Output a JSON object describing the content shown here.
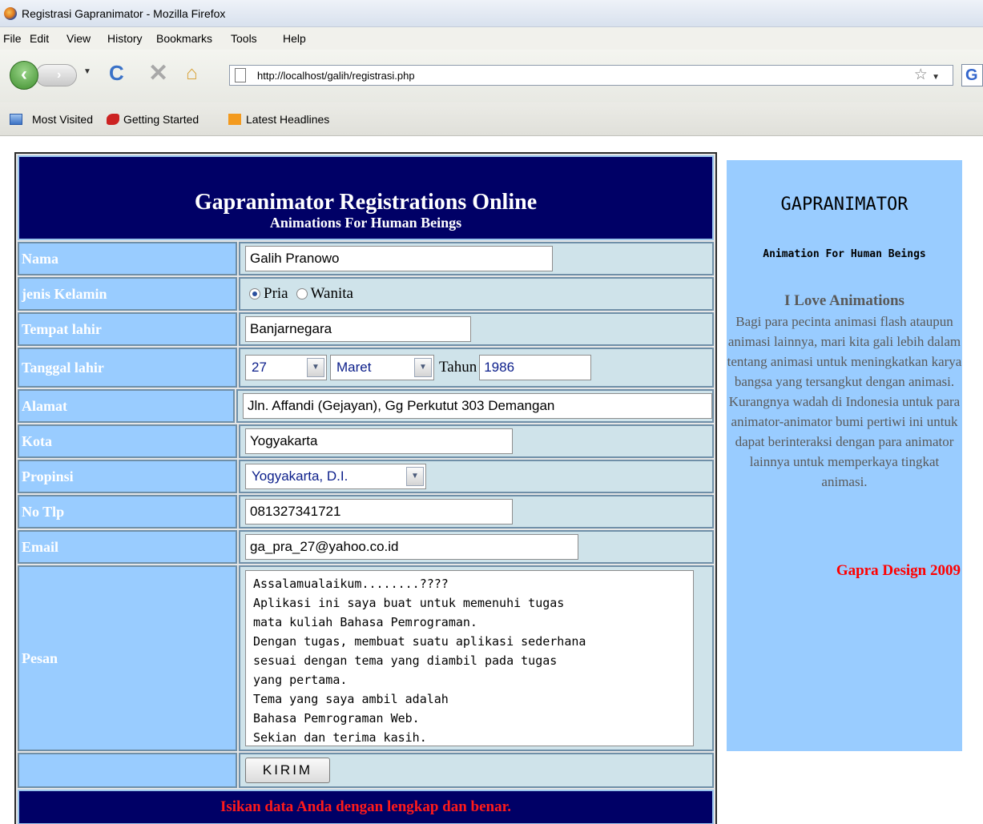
{
  "window": {
    "title": "Registrasi Gapranimator - Mozilla Firefox"
  },
  "menu": [
    "File",
    "Edit",
    "View",
    "History",
    "Bookmarks",
    "Tools",
    "Help"
  ],
  "toolbar": {
    "url": "http://localhost/galih/registrasi.php",
    "search_engine": "G"
  },
  "bookmarks": [
    "Most Visited",
    "Getting Started",
    "Latest Headlines"
  ],
  "form": {
    "title": "Gapranimator Registrations Online",
    "subtitle": "Animations For Human Beings",
    "fields": {
      "nama": {
        "label": "Nama",
        "value": "Galih Pranowo"
      },
      "gender": {
        "label": "jenis Kelamin",
        "options": [
          "Pria",
          "Wanita"
        ],
        "selected": "Pria"
      },
      "tempat_lahir": {
        "label": "Tempat lahir",
        "value": "Banjarnegara"
      },
      "tanggal_lahir": {
        "label": "Tanggal lahir",
        "day": "27",
        "month": "Maret",
        "year_label": "Tahun",
        "year": "1986"
      },
      "alamat": {
        "label": "Alamat",
        "value": "Jln. Affandi (Gejayan), Gg Perkutut 303 Demangan"
      },
      "kota": {
        "label": "Kota",
        "value": "Yogyakarta"
      },
      "propinsi": {
        "label": "Propinsi",
        "value": "Yogyakarta, D.I."
      },
      "no_tlp": {
        "label": "No Tlp",
        "value": "081327341721"
      },
      "email": {
        "label": "Email",
        "value": "ga_pra_27@yahoo.co.id"
      },
      "pesan": {
        "label": "Pesan",
        "value": "Assalamualaikum........????\nAplikasi ini saya buat untuk memenuhi tugas\nmata kuliah Bahasa Pemrograman.\nDengan tugas, membuat suatu aplikasi sederhana\nsesuai dengan tema yang diambil pada tugas\nyang pertama.\nTema yang saya ambil adalah\nBahasa Pemrograman Web.\nSekian dan terima kasih."
      }
    },
    "submit_label": "KIRIM",
    "footer_note": "Isikan data Anda dengan lengkap dan benar."
  },
  "sidebar": {
    "title": "GAPRANIMATOR",
    "subtitle": "Animation For Human Beings",
    "heading": "I Love Animations",
    "body": "Bagi para pecinta animasi flash ataupun animasi lainnya, mari kita gali lebih dalam tentang animasi untuk meningkatkan karya bangsa yang tersangkut dengan animasi. Kurangnya wadah di Indonesia untuk para animator-animator bumi pertiwi ini untuk dapat berinteraksi dengan para animator lainnya untuk memperkaya tingkat animasi.",
    "credit": "Gapra Design 2009"
  },
  "colors": {
    "header_bg": "#000066",
    "label_bg": "#99ccff",
    "value_bg": "#cfe3ea",
    "footer_text": "#ff1a1a",
    "sidebar_bg": "#99ccff",
    "credit_text": "#ff0000"
  }
}
